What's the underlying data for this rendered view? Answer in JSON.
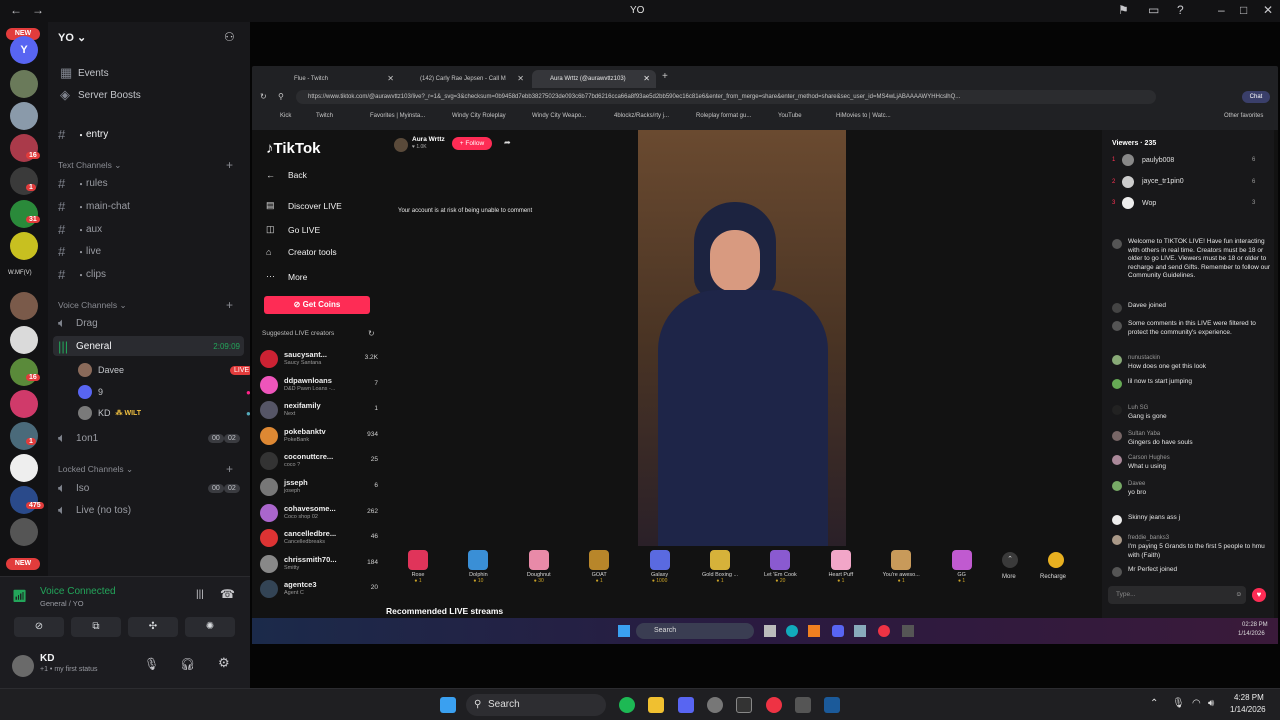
{
  "window": {
    "title": "YO"
  },
  "rail": {
    "new_top": "NEW",
    "new_bottom": "NEW",
    "badges": [
      "16",
      "1",
      "31",
      "1",
      "475",
      "16"
    ],
    "wmf": "W.MF(V)"
  },
  "server": {
    "name": "YO",
    "events": "Events",
    "boosts": "Server Boosts",
    "entry": "entry",
    "text_category": "Text Channels",
    "text_channels": [
      "rules",
      "main-chat",
      "aux",
      "live",
      "clips"
    ],
    "voice_category": "Voice Channels",
    "voice_channels": {
      "drag": "Drag",
      "general": "General",
      "general_time": "2:09:09",
      "oneonone": "1on1",
      "oneonone_count_a": "00",
      "oneonone_count_b": "02"
    },
    "voice_users": [
      {
        "name": "Davee",
        "badge": "LIVE"
      },
      {
        "name": "9"
      },
      {
        "name": "KD",
        "tag": "WILT"
      }
    ],
    "locked_category": "Locked Channels",
    "locked_channels": {
      "iso": "Iso",
      "iso_a": "00",
      "iso_b": "02",
      "live_no_tos": "Live (no tos)"
    }
  },
  "voice_panel": {
    "status": "Voice Connected",
    "location": "General / YO"
  },
  "user": {
    "name": "KD",
    "status": "my first status",
    "extra": "+1"
  },
  "browser": {
    "tabs": [
      "Flue - Twitch",
      "(142) Carly Rae Jepsen - Call M",
      "Aura Wrttz (@aurawvttz103)"
    ],
    "url": "https://www.tiktok.com/@aurawvttz103/live?_r=1&_svg=3&checksum=0b9458d7ebb38275023de093c6b77bd6216cca66a8f93ae5d2bb590ec16c81e6&enter_from_merge=share&enter_method=share&sec_user_id=MS4wLjABAAAAWYHHcslhQ...",
    "bookmarks": [
      "Kick",
      "Twitch",
      "Favorites | Myinsta...",
      "Windy City Roleplay",
      "Windy City Weapo...",
      "4blockz/Racks/rty j...",
      "Roleplay format gu...",
      "YouTube",
      "HiMovies to | Watc..."
    ],
    "other_favorites": "Other favorites"
  },
  "tiktok": {
    "logo": "TikTok",
    "back": "Back",
    "nav": [
      "Discover LIVE",
      "Go LIVE",
      "Creator tools",
      "More"
    ],
    "get_coins": "Get Coins",
    "suggested_title": "Suggested LIVE creators",
    "suggested": [
      {
        "name": "saucysant...",
        "sub": "Saucy Santana",
        "count": "3.2K"
      },
      {
        "name": "ddpawnloans",
        "sub": "D&D Pawn Loans -...",
        "count": "7"
      },
      {
        "name": "nexifamily",
        "sub": "Next",
        "count": "1"
      },
      {
        "name": "pokebanktv",
        "sub": "PokeBank",
        "count": "934"
      },
      {
        "name": "coconuttcre...",
        "sub": "coco ?",
        "count": "25"
      },
      {
        "name": "jsseph",
        "sub": "joseph",
        "count": "6"
      },
      {
        "name": "cohavesome...",
        "sub": "Coco shop 02",
        "count": "262"
      },
      {
        "name": "cancelledbre...",
        "sub": "Cancelledbreaks",
        "count": "46"
      },
      {
        "name": "chrissmith70...",
        "sub": "Smitty",
        "count": "184"
      },
      {
        "name": "agentce3",
        "sub": "Agent C",
        "count": "20"
      }
    ],
    "host_name": "Aura Wrttz",
    "host_likes": "1.0K",
    "follow": "+ Follow",
    "risk_notice": "Your account is at risk of being unable to comment",
    "recommended": "Recommended LIVE streams",
    "gifts": [
      {
        "name": "Rose",
        "cost": "1",
        "color": "#e0345a"
      },
      {
        "name": "Dolphin",
        "cost": "10",
        "color": "#3a8fd6"
      },
      {
        "name": "Doughnut",
        "cost": "30",
        "color": "#e88aa8"
      },
      {
        "name": "GOAT",
        "cost": "1",
        "color": "#b8862a"
      },
      {
        "name": "Galaxy",
        "cost": "1000",
        "color": "#5a6ae0"
      },
      {
        "name": "Gold Boxing ...",
        "cost": "1",
        "color": "#d6b23a"
      },
      {
        "name": "Let 'Em Cook",
        "cost": "20",
        "color": "#8a5ad0"
      },
      {
        "name": "Heart Puff",
        "cost": "1",
        "color": "#f2a6c8"
      },
      {
        "name": "You're aweso...",
        "cost": "1",
        "color": "#c89a5a"
      },
      {
        "name": "GG",
        "cost": "1",
        "color": "#c05ad0"
      }
    ],
    "more": "More",
    "recharge": "Recharge",
    "viewers_title": "Viewers · 235",
    "viewers": [
      {
        "rank": "1",
        "name": "paulyb008",
        "score": "6"
      },
      {
        "rank": "2",
        "name": "jayce_tr1pin0",
        "score": "6"
      },
      {
        "rank": "3",
        "name": "Wop",
        "score": "3"
      }
    ],
    "chat": [
      {
        "who": "",
        "text": "Welcome to TIKTOK LIVE! Have fun interacting with others in real time. Creators must be 18 or older to go LIVE. Viewers must be 18 or older to recharge and send Gifts. Remember to follow our Community Guidelines."
      },
      {
        "who": "",
        "text": "Davee  joined"
      },
      {
        "who": "",
        "text": "Some comments in this LIVE were filtered to protect the community's experience."
      },
      {
        "who": "nunustackin",
        "text": "How does one get this look"
      },
      {
        "who": "",
        "text": "lil now ts start jumping"
      },
      {
        "who": "Luh SG",
        "text": "Gang is gone"
      },
      {
        "who": "Sultan Yaba",
        "text": "Gingers do have souls"
      },
      {
        "who": "Carson Hughes",
        "text": "What u using"
      },
      {
        "who": "Davee",
        "text": "yo bro"
      },
      {
        "who": "",
        "text": "Skinny jeans ass j"
      },
      {
        "who": "freddie_banks3",
        "text": "I'm paying 5 Grands to the first 5 people to hmu with (Faith)"
      },
      {
        "who": "",
        "text": "Mr Perfect  joined"
      }
    ],
    "type_placeholder": "Type..."
  },
  "inner_taskbar": {
    "search": "Search",
    "time": "02:28 PM",
    "date": "1/14/2026"
  },
  "taskbar": {
    "search": "Search",
    "time": "4:28 PM",
    "date": "1/14/2026"
  }
}
